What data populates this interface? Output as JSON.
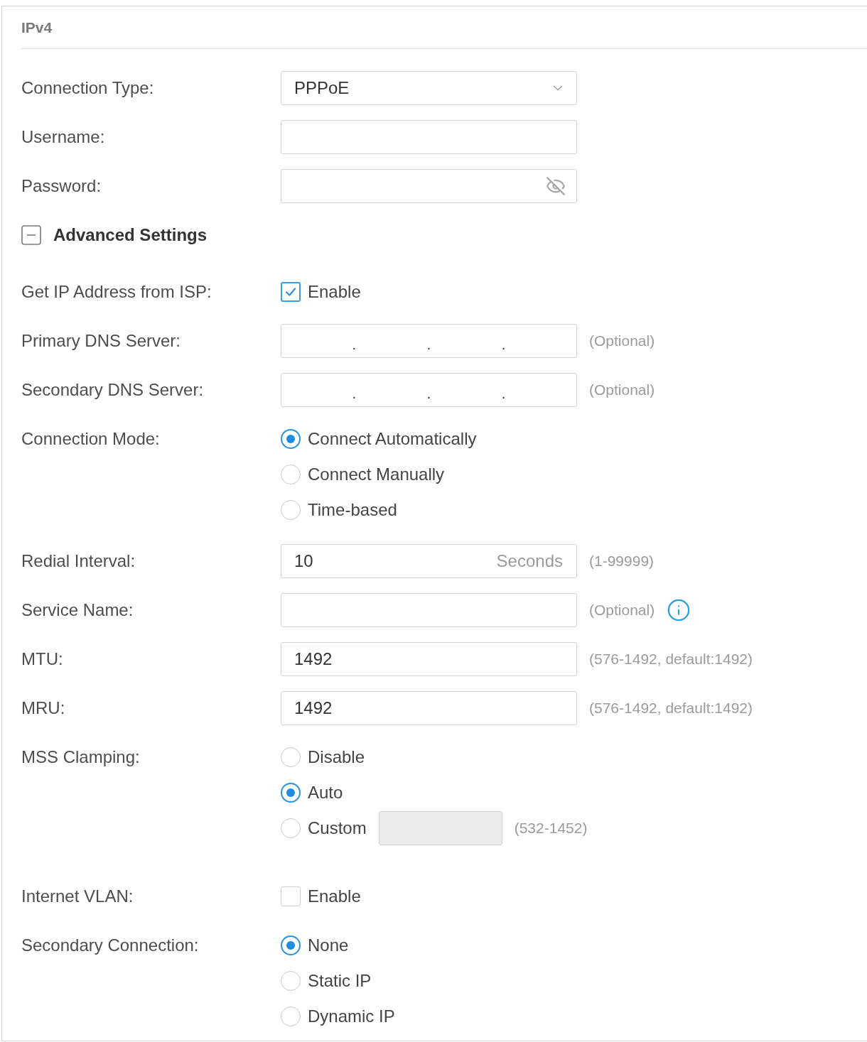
{
  "title": "IPv4",
  "rows": [
    {
      "kind": "select",
      "label": "Connection Type:",
      "value": "PPPoE"
    },
    {
      "kind": "text",
      "label": "Username:"
    },
    {
      "kind": "password",
      "label": "Password:"
    },
    {
      "kind": "section",
      "label": "Advanced Settings",
      "expanded": true
    },
    {
      "kind": "checkbox",
      "label": "Get IP Address from ISP:",
      "option": "Enable",
      "checked": true
    },
    {
      "kind": "ip",
      "label": "Primary DNS Server:",
      "separators": [
        ".",
        ".",
        "."
      ],
      "hint": "(Optional)"
    },
    {
      "kind": "ip",
      "label": "Secondary DNS Server:",
      "separators": [
        ".",
        ".",
        "."
      ],
      "hint": "(Optional)"
    },
    {
      "kind": "radio",
      "label": "Connection Mode:",
      "options": [
        {
          "label": "Connect Automatically",
          "selected": true
        },
        {
          "label": "Connect Manually",
          "selected": false
        },
        {
          "label": "Time-based",
          "selected": false
        }
      ]
    },
    {
      "kind": "text",
      "label": "Redial Interval:",
      "value": "10",
      "unit": "Seconds",
      "hint": "(1-99999)"
    },
    {
      "kind": "text",
      "label": "Service Name:",
      "hint": "(Optional)",
      "info": true
    },
    {
      "kind": "text",
      "label": "MTU:",
      "value": "1492",
      "hint": "(576-1492, default:1492)"
    },
    {
      "kind": "text",
      "label": "MRU:",
      "value": "1492",
      "hint": "(576-1492, default:1492)"
    },
    {
      "kind": "radio",
      "label": "MSS Clamping:",
      "options": [
        {
          "label": "Disable",
          "selected": false
        },
        {
          "label": "Auto",
          "selected": true
        },
        {
          "label": "Custom",
          "selected": false,
          "input": {
            "disabled": true,
            "hint": "(532-1452)"
          }
        }
      ]
    },
    {
      "kind": "checkbox",
      "label": "Internet VLAN:",
      "option": "Enable",
      "checked": false
    },
    {
      "kind": "radio",
      "label": "Secondary Connection:",
      "options": [
        {
          "label": "None",
          "selected": true
        },
        {
          "label": "Static IP",
          "selected": false
        },
        {
          "label": "Dynamic IP",
          "selected": false
        }
      ]
    }
  ]
}
